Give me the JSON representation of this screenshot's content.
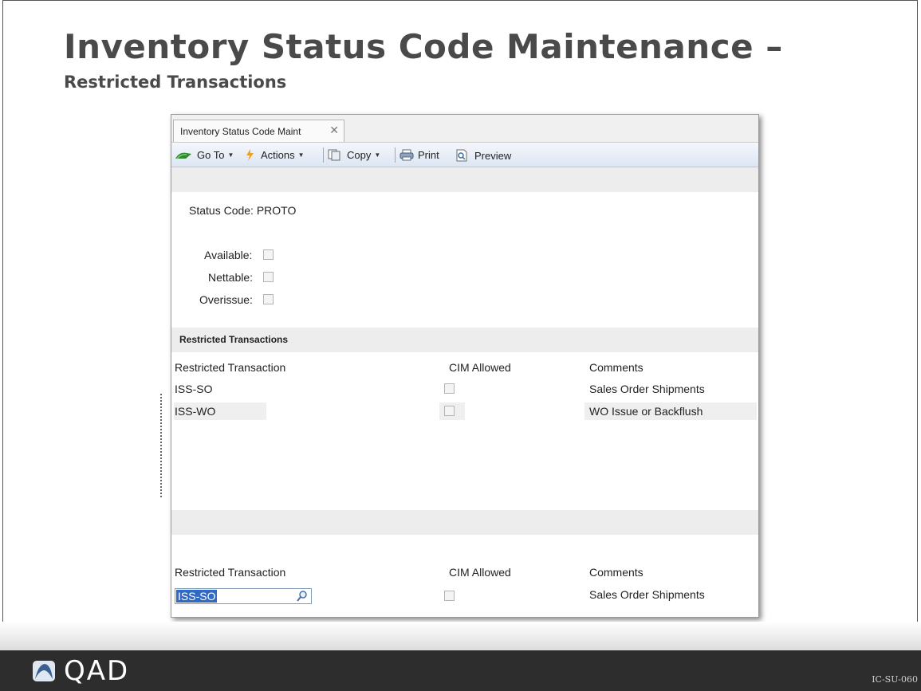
{
  "slide": {
    "title": "Inventory Status Code Maintenance –",
    "subtitle": "Restricted Transactions",
    "brand": "QAD",
    "code": "IC-SU-060"
  },
  "window": {
    "tab_title": "Inventory Status Code Maint",
    "tab_close": "✕",
    "toolbar": {
      "goto": "Go To",
      "actions": "Actions",
      "copy": "Copy",
      "print": "Print",
      "preview": "Preview"
    },
    "form": {
      "status_code_label": "Status Code:",
      "status_code_value": "PROTO",
      "available_label": "Available:",
      "nettable_label": "Nettable:",
      "overissue_label": "Overissue:"
    },
    "restricted": {
      "section_title": "Restricted Transactions",
      "columns": [
        "Restricted Transaction",
        "CIM Allowed",
        "Comments"
      ],
      "rows": [
        {
          "transaction": "ISS-SO",
          "cim_allowed": false,
          "comments": "Sales Order Shipments"
        },
        {
          "transaction": "ISS-WO",
          "cim_allowed": false,
          "comments": "WO Issue or Backflush"
        }
      ]
    },
    "detail": {
      "columns": [
        "Restricted Transaction",
        "CIM Allowed",
        "Comments"
      ],
      "transaction_value": "ISS-SO",
      "comments": "Sales Order Shipments"
    }
  },
  "colors": {
    "footer": "#2d2d2d",
    "selection": "#316ac5",
    "title": "#4a4a4a"
  }
}
